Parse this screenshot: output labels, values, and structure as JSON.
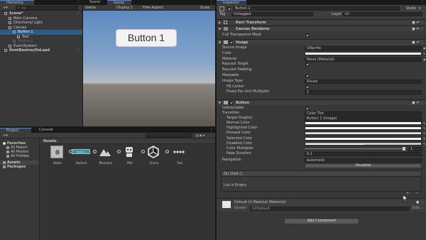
{
  "hierarchy": {
    "tab": "Hierarchy",
    "search_prefix": "All",
    "items": [
      {
        "label": "Scene*",
        "depth": 0,
        "selected": false,
        "dim": false
      },
      {
        "label": "Main Camera",
        "depth": 1,
        "selected": false,
        "dim": false
      },
      {
        "label": "Directional Light",
        "depth": 1,
        "selected": false,
        "dim": false
      },
      {
        "label": "Canvas",
        "depth": 1,
        "selected": false,
        "dim": false
      },
      {
        "label": "Button 1",
        "depth": 2,
        "selected": true,
        "dim": false
      },
      {
        "label": "Text",
        "depth": 3,
        "selected": false,
        "dim": false
      },
      {
        "label": "Button 2",
        "depth": 2,
        "selected": false,
        "dim": true
      },
      {
        "label": "EventSystem",
        "depth": 1,
        "selected": false,
        "dim": false
      },
      {
        "label": "DontDestroyOnLoad",
        "depth": 0,
        "selected": false,
        "dim": false
      }
    ]
  },
  "game": {
    "tabs": [
      "Scene",
      "Game"
    ],
    "toolbar": {
      "mode": "Game",
      "display": "Display 1",
      "aspect": "Free Aspect",
      "scale": "Scale"
    },
    "button_text": "Button 1"
  },
  "project": {
    "tabs": [
      "Project",
      "Console"
    ],
    "tree": [
      {
        "label": "Favorites",
        "depth": 0,
        "bold": true
      },
      {
        "label": "All Materi",
        "depth": 1,
        "bold": false
      },
      {
        "label": "All Models",
        "depth": 1,
        "bold": false
      },
      {
        "label": "All Prefabs",
        "depth": 1,
        "bold": false
      },
      {
        "label": "Assets",
        "depth": 0,
        "bold": true
      },
      {
        "label": "Packages",
        "depth": 0,
        "bold": true
      }
    ],
    "breadcrumb": "Assets",
    "assets": [
      {
        "label": "Bibba",
        "icon": "image-icon"
      },
      {
        "label": "Button1",
        "icon": "button-prefab-icon"
      },
      {
        "label": "Mountain",
        "icon": "mountain-icon"
      },
      {
        "label": "PNG",
        "icon": "robot-icon"
      },
      {
        "label": "Scene",
        "icon": "unity-scene-icon"
      },
      {
        "label": "Tree",
        "icon": "tree-icon"
      }
    ]
  },
  "inspector": {
    "tab": "Inspector",
    "object_name": "Button 1",
    "static_label": "Static",
    "tag_label": "Tag",
    "tag_value": "Untagged",
    "layer_label": "Layer",
    "layer_value": "UI",
    "rect_transform": "Rect Transform",
    "canvas_renderer": "Canvas Renderer",
    "cull_label": "Cull Transparent Mesh",
    "image": {
      "title": "Image",
      "rows": [
        {
          "label": "Source Image",
          "value": "UISprite"
        },
        {
          "label": "Color",
          "value": ""
        },
        {
          "label": "Material",
          "value": "None (Material)"
        },
        {
          "label": "Raycast Target",
          "value": ""
        },
        {
          "label": "Raycast Padding",
          "value": ""
        },
        {
          "label": "Maskable",
          "value": ""
        },
        {
          "label": "Image Type",
          "value": "Sliced"
        },
        {
          "label": "Fill Center",
          "value": ""
        },
        {
          "label": "Pixels Per Unit Multiplier",
          "value": "1"
        }
      ]
    },
    "button": {
      "title": "Button",
      "interactable": "Interactable",
      "transition_label": "Transition",
      "transition_value": "Color Tint",
      "target_graphic_label": "Target Graphic",
      "target_graphic_value": "Button 1 (Image)",
      "colors": [
        "Normal Color",
        "Highlighted Color",
        "Pressed Color",
        "Selected Color",
        "Disabled Color"
      ],
      "color_multiplier_label": "Color Multiplier",
      "color_multiplier_value": "1",
      "fade_label": "Fade Duration",
      "fade_value": "0.1",
      "navigation_label": "Navigation",
      "navigation_value": "Automatic",
      "visualize": "Visualize",
      "onclick": "On Click ()",
      "list_empty": "List is Empty"
    },
    "material": {
      "name": "Default UI Material (Material)",
      "shader_label": "Shader",
      "shader_value": "UI/Default",
      "edit": "Edit..."
    },
    "add_component": "Add Component"
  },
  "colors": {
    "accent": "#2c5d87",
    "selected_row": "#2c5d87",
    "panel": "#383838",
    "dark": "#191919"
  }
}
